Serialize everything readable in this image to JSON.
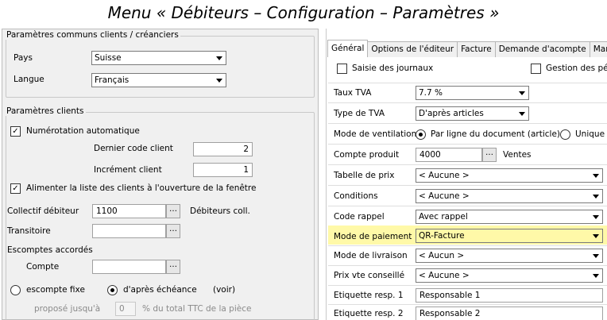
{
  "caption": "Menu « Débiteurs – Configuration – Paramètres »",
  "left": {
    "common": {
      "legend": "Paramètres communs clients / créanciers",
      "country_label": "Pays",
      "country_value": "Suisse",
      "language_label": "Langue",
      "language_value": "Français"
    },
    "clients": {
      "legend": "Paramètres clients",
      "auto_numbering_label": "Numérotation automatique",
      "auto_numbering_checked": true,
      "last_code_label": "Dernier code client",
      "last_code_value": "2",
      "increment_label": "Incrément client",
      "increment_value": "1",
      "feed_list_label": "Alimenter la liste des clients à l'ouverture de la fenêtre",
      "feed_list_checked": true,
      "collective_label": "Collectif débiteur",
      "collective_value": "1100",
      "collective_desc": "Débiteurs coll.",
      "transit_label": "Transitoire",
      "transit_value": "",
      "discount_title": "Escomptes accordés",
      "account_label": "Compte",
      "account_value": "",
      "radio_fixed_label": "escompte fixe",
      "radio_due_label": "d'après échéance",
      "see_label": "(voir)",
      "proposed_label": "proposé jusqu'à",
      "proposed_value": "0",
      "proposed_suffix": "% du total TTC de la pièce"
    }
  },
  "right": {
    "tabs": [
      "Général",
      "Options de l'éditeur",
      "Facture",
      "Demande d'acompte",
      "Manda"
    ],
    "active_tab": "Général",
    "journal_entry_label": "Saisie des journaux",
    "periods_label": "Gestion des péri",
    "vat_rate_label": "Taux TVA",
    "vat_rate_value": "7.7 %",
    "vat_type_label": "Type de TVA",
    "vat_type_value": "D'après articles",
    "breakdown_label": "Mode de ventilation",
    "breakdown_opt1": "Par ligne du document (article)",
    "breakdown_opt2": "Unique p",
    "product_account_label": "Compte produit",
    "product_account_value": "4000",
    "product_account_desc": "Ventes",
    "price_table_label": "Tabelle de prix",
    "price_table_value": "< Aucune >",
    "conditions_label": "Conditions",
    "conditions_value": "< Aucune >",
    "reminder_label": "Code rappel",
    "reminder_value": "Avec rappel",
    "payment_label": "Mode de paiement",
    "payment_value": "QR-Facture",
    "delivery_label": "Mode de livraison",
    "delivery_value": "< Aucun >",
    "retail_price_label": "Prix vte conseillé",
    "retail_price_value": "< Aucune >",
    "resp1_label": "Etiquette resp. 1",
    "resp1_value": "Responsable 1",
    "resp2_label": "Etiquette resp. 2",
    "resp2_value": "Responsable 2",
    "highlight_color": "#fff9a8"
  }
}
